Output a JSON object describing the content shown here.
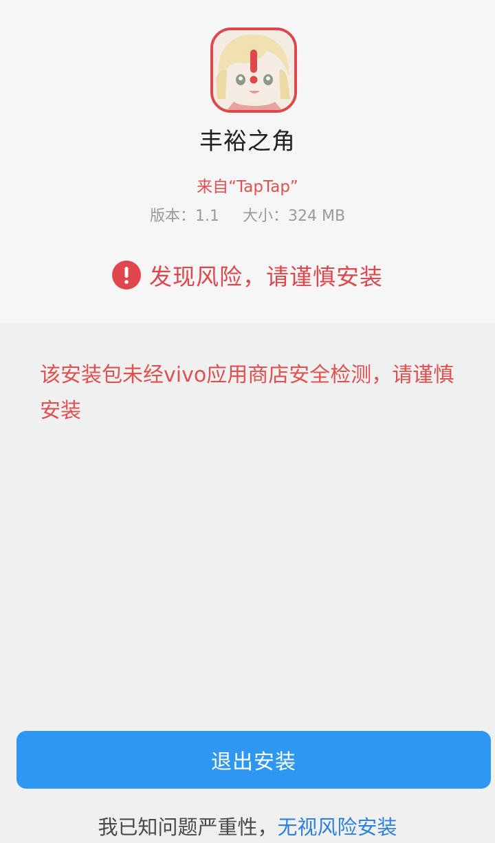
{
  "app": {
    "name": "丰裕之角",
    "icon_name": "app-icon-anime-warning",
    "source": "来自“TapTap”",
    "version_label": "版本：",
    "version": "1.1",
    "size_label": "大小：",
    "size": "324 MB"
  },
  "risk": {
    "icon_name": "exclamation-circle-icon",
    "title": "发现风险，请谨慎安装",
    "description": "该安装包未经vivo应用商店安全检测，请谨慎安装"
  },
  "actions": {
    "exit_label": "退出安装",
    "acknowledge_prefix": "我已知问题严重性，",
    "ignore_label": "无视风险安装"
  },
  "colors": {
    "danger": "#e0474c",
    "primary_button": "#2d97f2",
    "link": "#2d7fe0"
  }
}
